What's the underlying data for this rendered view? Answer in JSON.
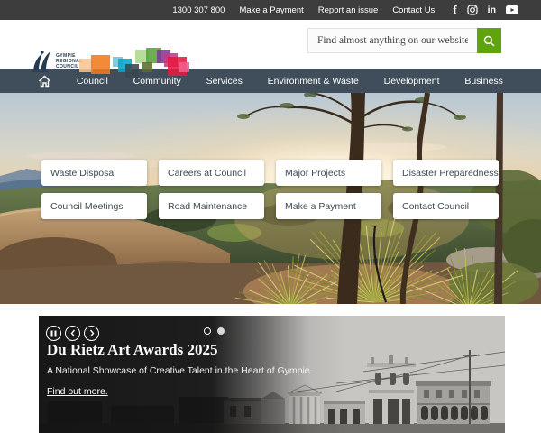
{
  "topbar": {
    "phone": "1300 307 800",
    "links": [
      "Make a Payment",
      "Report an issue",
      "Contact Us"
    ],
    "social_icons": [
      "facebook",
      "instagram",
      "linkedin",
      "youtube"
    ]
  },
  "header": {
    "logo": {
      "lines": [
        "GYMPIE",
        "REGIONAL",
        "COUNCIL"
      ],
      "palette": [
        "#f6c493",
        "#ef7b1f",
        "#69c8d8",
        "#0aa6c6",
        "#3a474d",
        "#abd88e",
        "#59a23c",
        "#5c6b2f",
        "#7e3a92",
        "#c23a86",
        "#e51a41",
        "#ef5e8c"
      ]
    },
    "search": {
      "placeholder": "Find almost anything on our website",
      "value": ""
    }
  },
  "nav": {
    "items": [
      "Council",
      "Community",
      "Services",
      "Environment & Waste",
      "Development",
      "Business"
    ]
  },
  "quicklinks": {
    "items": [
      "Waste Disposal",
      "Careers at Council",
      "Major Projects",
      "Disaster Preparedness",
      "Council Meetings",
      "Road Maintenance",
      "Make a Payment",
      "Contact Council"
    ]
  },
  "carousel": {
    "title": "Du Rietz Art Awards 2025",
    "subtitle": "A National Showcase of Creative Talent in the Heart of Gympie.",
    "link": "Find out more.",
    "dot_count": 2,
    "active_dot": 2
  },
  "colors": {
    "accent_green": "#5fa30d",
    "nav_bar": "#3f4e5a",
    "top_bar": "#3d3d3d",
    "carousel_bg": "#181818"
  }
}
